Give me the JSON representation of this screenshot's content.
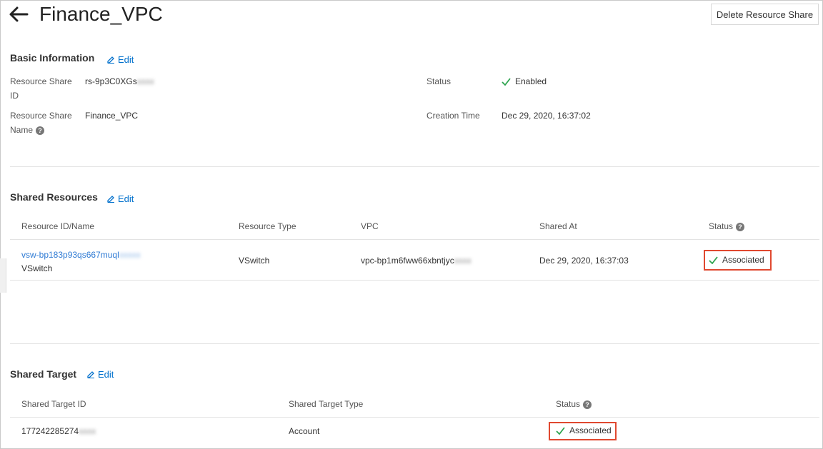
{
  "header": {
    "title": "Finance_VPC",
    "delete_button": "Delete Resource Share"
  },
  "basic": {
    "heading": "Basic Information",
    "edit": "Edit",
    "id_label_1": "Resource Share",
    "id_label_2": "ID",
    "id_value": "rs-9p3C0XGs",
    "id_masked": "xxxx",
    "name_label_1": "Resource Share",
    "name_label_2": "Name",
    "name_value": "Finance_VPC",
    "status_label": "Status",
    "status_value": "Enabled",
    "created_label": "Creation Time",
    "created_value": "Dec 29, 2020, 16:37:02"
  },
  "resources": {
    "heading": "Shared Resources",
    "edit": "Edit",
    "columns": [
      "Resource ID/Name",
      "Resource Type",
      "VPC",
      "Shared At",
      "Status"
    ],
    "rows": [
      {
        "id": "vsw-bp183p93qs667muql",
        "id_masked": "xxxxx",
        "name": "VSwitch",
        "type": "VSwitch",
        "vpc": "vpc-bp1m6fww66xbntjyc",
        "vpc_masked": "xxxx",
        "shared_at": "Dec 29, 2020, 16:37:03",
        "status": "Associated"
      }
    ]
  },
  "targets": {
    "heading": "Shared Target",
    "edit": "Edit",
    "columns": [
      "Shared Target ID",
      "Shared Target Type",
      "Status"
    ],
    "rows": [
      {
        "id": "177242285274",
        "id_masked": "xxxx",
        "type": "Account",
        "status": "Associated"
      }
    ]
  },
  "colors": {
    "link": "#2f7bd4",
    "success": "#2ea44f",
    "highlight": "#e0482f"
  },
  "icons": {
    "back": "arrow-left-icon",
    "edit": "pencil-icon",
    "check": "check-icon",
    "help": "question-circle-icon"
  }
}
